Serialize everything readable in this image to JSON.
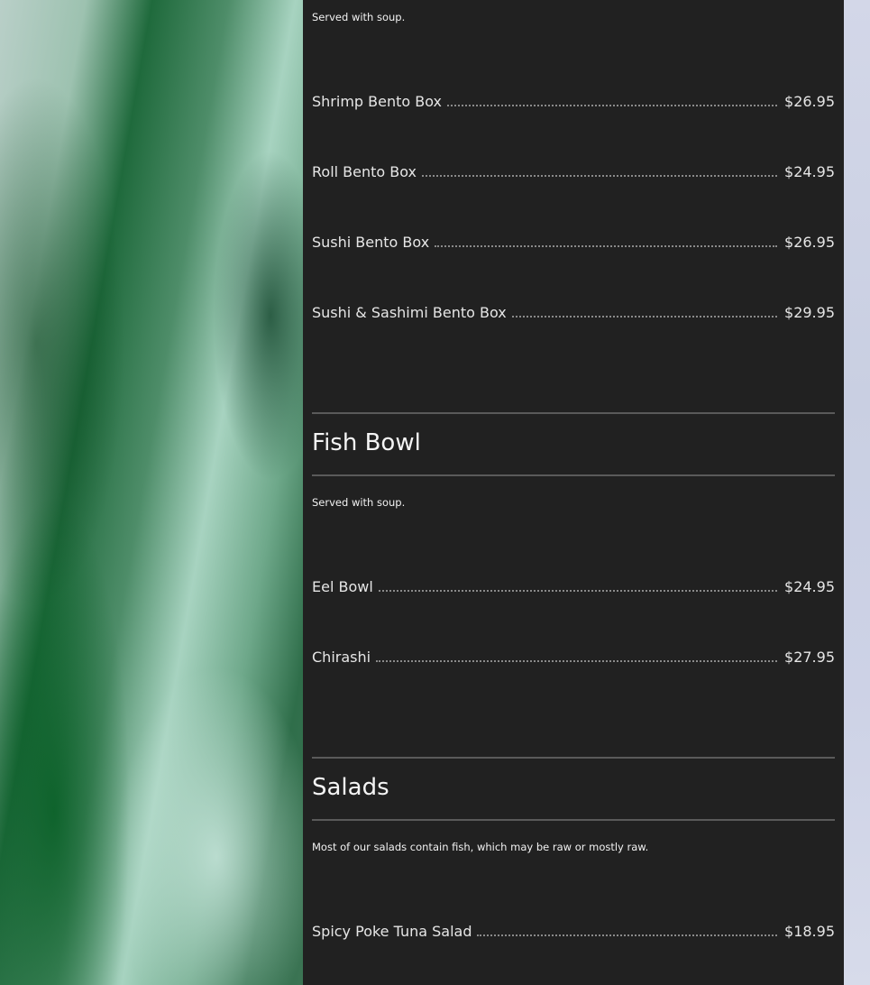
{
  "bento": {
    "note": "Served with soup.",
    "items": [
      {
        "name": "Shrimp Bento Box",
        "price": "$26.95"
      },
      {
        "name": "Roll Bento Box",
        "price": "$24.95"
      },
      {
        "name": "Sushi Bento Box",
        "price": "$26.95"
      },
      {
        "name": "Sushi & Sashimi Bento Box",
        "price": "$29.95"
      }
    ]
  },
  "fish_bowl": {
    "title": "Fish Bowl",
    "note": "Served with soup.",
    "items": [
      {
        "name": "Eel Bowl",
        "price": "$24.95"
      },
      {
        "name": "Chirashi",
        "price": "$27.95"
      }
    ]
  },
  "salads": {
    "title": "Salads",
    "note": "Most of our salads contain fish, which may be raw or mostly raw.",
    "items": [
      {
        "name": "Spicy Poke Tuna Salad",
        "price": "$18.95"
      }
    ]
  },
  "colors": {
    "panel_bg": "#212121",
    "text": "#e6e6e6",
    "rule": "#5a5a5a",
    "side_strip": "#cdd2e6"
  }
}
